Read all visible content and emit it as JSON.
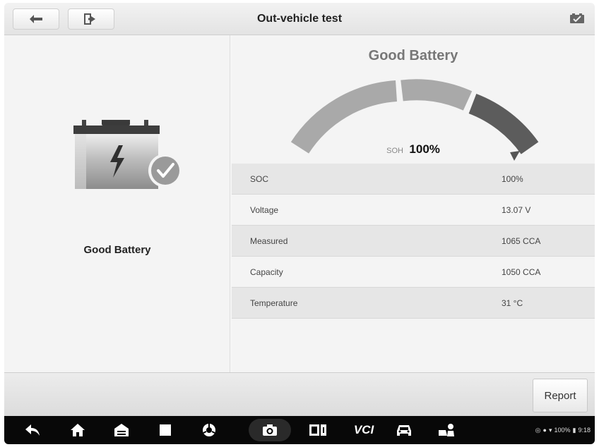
{
  "header": {
    "title": "Out-vehicle test"
  },
  "left_panel": {
    "label": "Good Battery"
  },
  "result": {
    "title": "Good Battery",
    "soh_label": "SOH",
    "soh_value": "100%",
    "gauge_percent": 100
  },
  "table": {
    "rows": [
      {
        "label": "SOC",
        "value": "100%"
      },
      {
        "label": "Voltage",
        "value": "13.07 V"
      },
      {
        "label": "Measured",
        "value": "1065 CCA"
      },
      {
        "label": "Capacity",
        "value": "1050 CCA"
      },
      {
        "label": "Temperature",
        "value": "31 °C"
      }
    ]
  },
  "actions": {
    "report_label": "Report"
  },
  "navbar": {
    "vci_label": "VCI",
    "battery_text": "100%",
    "time": "9:18"
  },
  "colors": {
    "gauge_light": "#a9a9a9",
    "gauge_dark": "#5c5c5c",
    "check_badge": "#9a9a9a"
  },
  "icons": [
    "back-arrow-icon",
    "exit-icon",
    "battery-status-icon",
    "nav-back-icon",
    "home-icon",
    "garage-icon",
    "recent-apps-icon",
    "browser-icon",
    "camera-icon",
    "screen-mirror-icon",
    "car-icon",
    "service-icon"
  ]
}
